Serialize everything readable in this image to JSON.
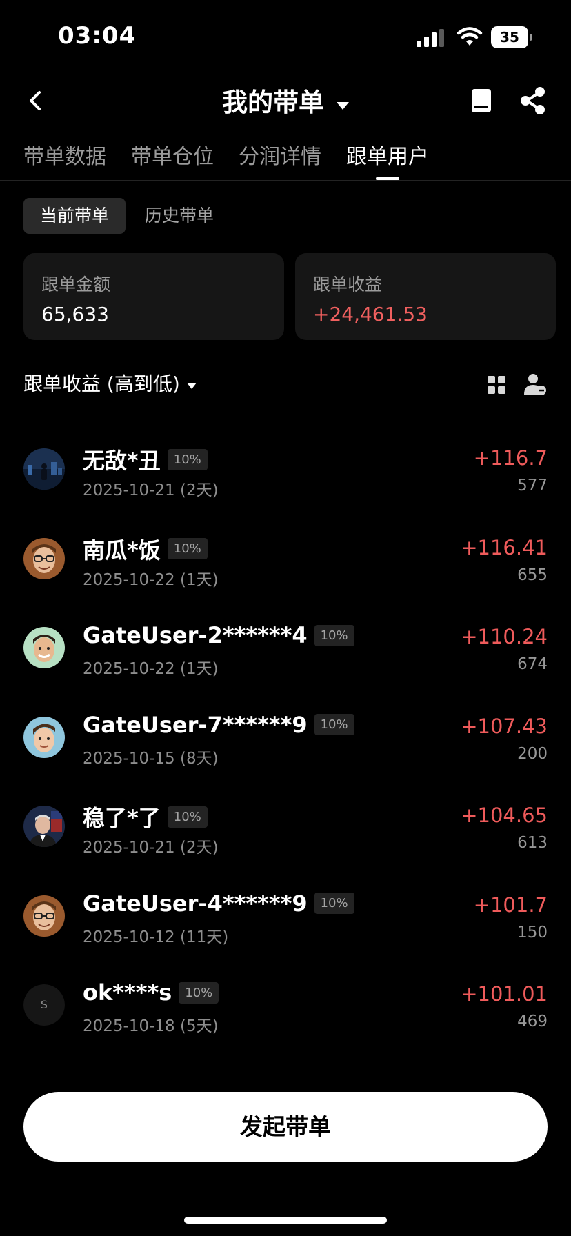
{
  "status_bar": {
    "time": "03:04",
    "battery": "35"
  },
  "header": {
    "title": "我的带单"
  },
  "tabs": [
    {
      "label": "带单数据"
    },
    {
      "label": "带单仓位"
    },
    {
      "label": "分润详情"
    },
    {
      "label": "跟单用户",
      "active": true
    }
  ],
  "sub_tabs": [
    {
      "label": "当前带单",
      "active": true
    },
    {
      "label": "历史带单"
    }
  ],
  "summary": {
    "follow_amount": {
      "label": "跟单金额",
      "value": "65,633"
    },
    "follow_profit": {
      "label": "跟单收益",
      "value": "+24,461.53"
    }
  },
  "sort": {
    "label": "跟单收益 (高到低)"
  },
  "followers": [
    {
      "name": "无敌*丑",
      "ratio": "10%",
      "date": "2025-10-21 (2天)",
      "profit": "+116.7",
      "amount": "577",
      "avatar": "night-city-avatar"
    },
    {
      "name": "南瓜*饭",
      "ratio": "10%",
      "date": "2025-10-22 (1天)",
      "profit": "+116.41",
      "amount": "655",
      "avatar": "glasses-man-avatar"
    },
    {
      "name": "GateUser-2******4",
      "ratio": "10%",
      "date": "2025-10-22 (1天)",
      "profit": "+110.24",
      "amount": "674",
      "avatar": "smiling-man-avatar"
    },
    {
      "name": "GateUser-7******9",
      "ratio": "10%",
      "date": "2025-10-15 (8天)",
      "profit": "+107.43",
      "amount": "200",
      "avatar": "young-man-avatar"
    },
    {
      "name": "稳了*了",
      "ratio": "10%",
      "date": "2025-10-21 (2天)",
      "profit": "+104.65",
      "amount": "613",
      "avatar": "speaker-avatar"
    },
    {
      "name": "GateUser-4******9",
      "ratio": "10%",
      "date": "2025-10-12 (11天)",
      "profit": "+101.7",
      "amount": "150",
      "avatar": "glasses-man-avatar"
    },
    {
      "name": "ok****s",
      "ratio": "10%",
      "date": "2025-10-18 (5天)",
      "profit": "+101.01",
      "amount": "469",
      "avatar_letter": "S"
    }
  ],
  "footer": {
    "start_button": "发起带单"
  },
  "colors": {
    "positive": "#ef5b5b",
    "background": "#000000",
    "card": "#161616"
  }
}
